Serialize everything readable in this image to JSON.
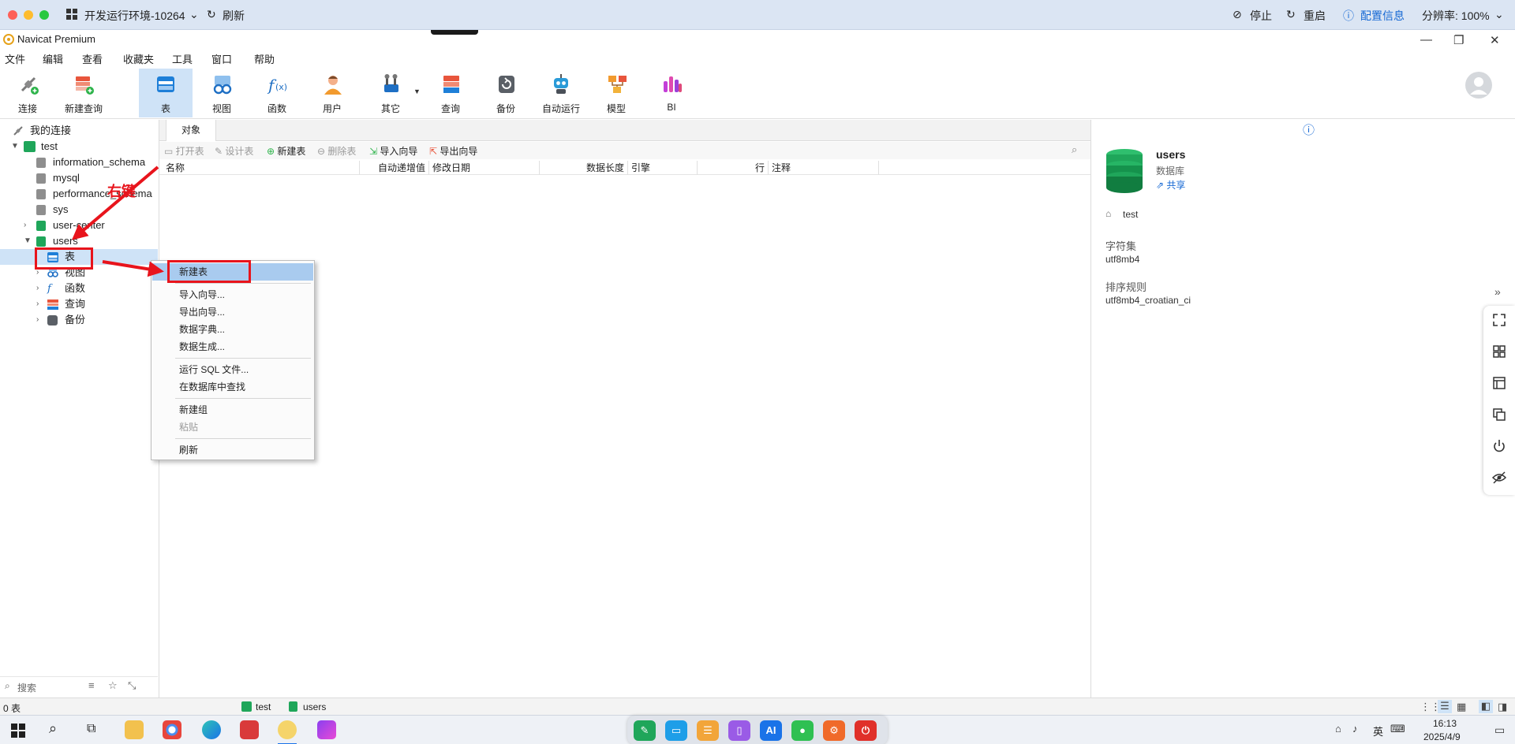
{
  "remote_bar": {
    "env_title": "开发运行环境-10264",
    "refresh": "刷新",
    "stop": "停止",
    "restart": "重启",
    "config": "配置信息",
    "resolution": "分辨率: 100%"
  },
  "window": {
    "title": "Navicat Premium"
  },
  "menu": [
    "文件",
    "编辑",
    "查看",
    "收藏夹",
    "工具",
    "窗口",
    "帮助"
  ],
  "toolbar": [
    {
      "label": "连接",
      "icon": "connection-icon"
    },
    {
      "label": "新建查询",
      "icon": "new-query-icon"
    },
    {
      "label": "表",
      "icon": "table-icon"
    },
    {
      "label": "视图",
      "icon": "view-icon"
    },
    {
      "label": "函数",
      "icon": "function-icon"
    },
    {
      "label": "用户",
      "icon": "user-icon"
    },
    {
      "label": "其它",
      "icon": "tools-icon"
    },
    {
      "label": "查询",
      "icon": "query-icon"
    },
    {
      "label": "备份",
      "icon": "backup-icon"
    },
    {
      "label": "自动运行",
      "icon": "robot-icon"
    },
    {
      "label": "模型",
      "icon": "model-icon"
    },
    {
      "label": "BI",
      "icon": "bi-icon"
    }
  ],
  "nav": {
    "root": "我的连接",
    "connection": "test",
    "databases": [
      "information_schema",
      "mysql",
      "performance_schema",
      "sys",
      "user-center",
      "users"
    ],
    "children": [
      "表",
      "视图",
      "函数",
      "查询",
      "备份"
    ],
    "search_placeholder": "搜索"
  },
  "objects": {
    "tab": "对象",
    "toolbar": [
      "打开表",
      "设计表",
      "新建表",
      "删除表",
      "导入向导",
      "导出向导"
    ],
    "columns": [
      "名称",
      "自动递增值",
      "修改日期",
      "数据长度",
      "引擎",
      "行",
      "注释"
    ]
  },
  "info": {
    "name": "users",
    "type": "数据库",
    "share": "共享",
    "connection": "test",
    "charset_label": "字符集",
    "charset_value": "utf8mb4",
    "collation_label": "排序规则",
    "collation_value": "utf8mb4_croatian_ci"
  },
  "context_menu": {
    "new_table": "新建表",
    "import": "导入向导...",
    "export": "导出向导...",
    "dictionary": "数据字典...",
    "generate": "数据生成...",
    "run_sql": "运行 SQL 文件...",
    "find": "在数据库中查找",
    "new_group": "新建组",
    "paste": "粘贴",
    "refresh": "刷新"
  },
  "annotation": {
    "text": "右键",
    "color": "#e8141c"
  },
  "status": {
    "count": "0 表",
    "connection": "test",
    "database": "users"
  },
  "taskbar": {
    "time": "16:13",
    "date": "2025/4/9",
    "ime": "英",
    "dock_ai": "AI"
  },
  "colors": {
    "accent": "#1769d4",
    "selection": "#cfe3f7",
    "menu_highlight": "#a9cbef",
    "db_green": "#1fa65a"
  }
}
